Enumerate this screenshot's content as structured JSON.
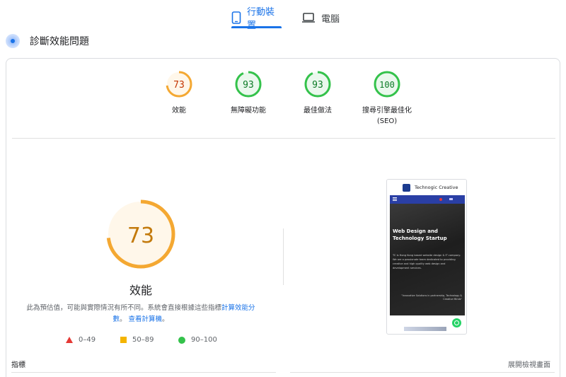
{
  "tabs": {
    "mobile_label": "行動裝置",
    "desktop_label": "電腦"
  },
  "diagnose": {
    "title": "診斷效能問題"
  },
  "categories": [
    {
      "label": "效能",
      "score": "73",
      "value": 73,
      "color": "#f4a832",
      "text_color": "#c33300",
      "bg": "#fff7ea"
    },
    {
      "label": "無障礙功能",
      "score": "93",
      "value": 93,
      "color": "#34c24b",
      "text_color": "#0b7a25",
      "bg": "#eaf8ed"
    },
    {
      "label": "最佳做法",
      "score": "93",
      "value": 93,
      "color": "#34c24b",
      "text_color": "#0b7a25",
      "bg": "#eaf8ed"
    },
    {
      "label": "搜尋引擎最佳化",
      "label2": "(SEO)",
      "score": "100",
      "value": 100,
      "color": "#34c24b",
      "text_color": "#0b7a25",
      "bg": "#eaf8ed"
    }
  ],
  "performance": {
    "score": "73",
    "value": 73,
    "title": "效能",
    "disclaimer_prefix": "此為預估值，可能與實際情況有所不同。系統會直接根據這些指標",
    "disclaimer_link1": "計算效能分數",
    "disclaimer_sep": "。",
    "disclaimer_link2": "查看計算機",
    "disclaimer_suffix": "。"
  },
  "legend": {
    "poor": "0–49",
    "average": "50–89",
    "good": "90–100"
  },
  "screenshot": {
    "brand": "Technogic Creative",
    "hero_title": "Web Design and Technology Startup",
    "hero_text": "TC is Hong Kong based website design & IT company. We are a passionate team dedicated to providing creative and high quality web design and development services.",
    "hero_sub": "\"Innovative Solutions in partnership, Technology & Creative Minds\""
  },
  "footer": {
    "metrics_label": "指標",
    "expand_label": "展開檢視畫面"
  },
  "colors": {
    "accent": "#1a73e8",
    "average": "#f4a832",
    "good": "#34c24b",
    "poor": "#e53935"
  }
}
